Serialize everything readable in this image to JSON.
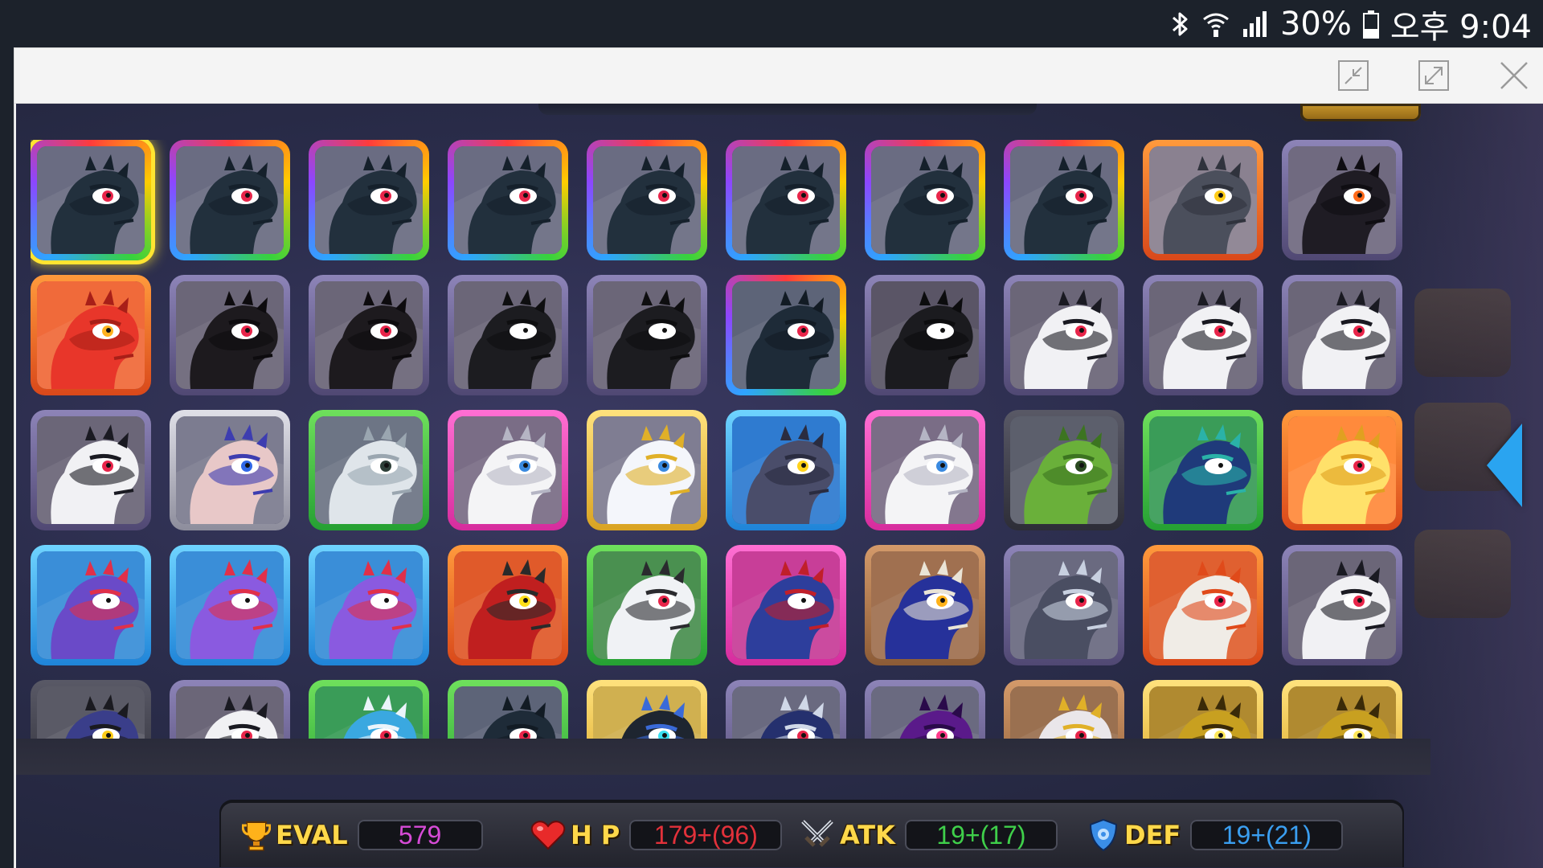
{
  "status_bar": {
    "battery_percent": "30%",
    "time": "오후 9:04",
    "icons": [
      "bluetooth-icon",
      "wifi-icon",
      "signal-icon",
      "battery-icon"
    ]
  },
  "window_controls": [
    "minimize-icon",
    "maximize-icon",
    "close-icon"
  ],
  "stats": {
    "eval": {
      "label": "EVAL",
      "value": "579",
      "color": "#d64bd6"
    },
    "hp": {
      "label": "H P",
      "value": "179+(96)",
      "color": "#e2313a"
    },
    "atk": {
      "label": "ATK",
      "value": "19+(17)",
      "color": "#3fcf4a"
    },
    "def": {
      "label": "DEF",
      "value": "19+(21)",
      "color": "#3a9ef0"
    }
  },
  "grid": {
    "columns": 10,
    "slots": [
      {
        "frame": "rainbow",
        "selected": true,
        "dragon": "dark-godzilla"
      },
      {
        "frame": "rainbow",
        "dragon": "dark-godzilla"
      },
      {
        "frame": "rainbow",
        "dragon": "dark-godzilla"
      },
      {
        "frame": "rainbow",
        "dragon": "dark-godzilla"
      },
      {
        "frame": "rainbow",
        "dragon": "dark-godzilla"
      },
      {
        "frame": "rainbow",
        "dragon": "dark-godzilla"
      },
      {
        "frame": "rainbow",
        "dragon": "dark-godzilla"
      },
      {
        "frame": "rainbow",
        "dragon": "dark-godzilla"
      },
      {
        "frame": "orange",
        "dragon": "gray-spiky"
      },
      {
        "frame": "purple",
        "dragon": "black-fire"
      },
      {
        "frame": "orange",
        "dragon": "red-baby"
      },
      {
        "frame": "purple",
        "dragon": "shadow"
      },
      {
        "frame": "purple",
        "dragon": "shadow"
      },
      {
        "frame": "purple",
        "dragon": "black-gem"
      },
      {
        "frame": "purple",
        "dragon": "black-gem"
      },
      {
        "frame": "rainbow",
        "dragon": "teal-horn"
      },
      {
        "frame": "purple",
        "dragon": "black-gold"
      },
      {
        "frame": "purple",
        "dragon": "white-tribal"
      },
      {
        "frame": "purple",
        "dragon": "white-tribal"
      },
      {
        "frame": "purple",
        "dragon": "white-tribal"
      },
      {
        "frame": "purple",
        "dragon": "white-tribal"
      },
      {
        "frame": "silver",
        "dragon": "blue-lily"
      },
      {
        "frame": "green",
        "dragon": "white-ghost"
      },
      {
        "frame": "pink",
        "dragon": "white-flower"
      },
      {
        "frame": "gold",
        "dragon": "white-gold"
      },
      {
        "frame": "blue",
        "dragon": "steel-bird"
      },
      {
        "frame": "pink",
        "dragon": "white-flower"
      },
      {
        "frame": "dark",
        "dragon": "green-cactus"
      },
      {
        "frame": "green",
        "dragon": "blue-parrot"
      },
      {
        "frame": "orange",
        "dragon": "yellow-baby"
      },
      {
        "frame": "blue",
        "dragon": "purple-coral"
      },
      {
        "frame": "blue",
        "dragon": "purple-baby"
      },
      {
        "frame": "blue",
        "dragon": "purple-baby"
      },
      {
        "frame": "orange",
        "dragon": "red-green"
      },
      {
        "frame": "green",
        "dragon": "white-ram"
      },
      {
        "frame": "pink",
        "dragon": "blue-scroll"
      },
      {
        "frame": "bronze",
        "dragon": "navy-white"
      },
      {
        "frame": "purple",
        "dragon": "silver-armor"
      },
      {
        "frame": "orange",
        "dragon": "fire-white"
      },
      {
        "frame": "purple",
        "dragon": "white-tribal"
      },
      {
        "frame": "dark",
        "dragon": "top-hat"
      },
      {
        "frame": "purple",
        "dragon": "white-tribal"
      },
      {
        "frame": "green",
        "dragon": "ice-blue"
      },
      {
        "frame": "green",
        "dragon": "teal-horn"
      },
      {
        "frame": "gold",
        "dragon": "dark-cyan-eye"
      },
      {
        "frame": "purple",
        "dragon": "navy-armor"
      },
      {
        "frame": "purple",
        "dragon": "purple-armor"
      },
      {
        "frame": "bronze",
        "dragon": "gold-white"
      },
      {
        "frame": "gold",
        "dragon": "gold-spike"
      },
      {
        "frame": "gold",
        "dragon": "gold-spike"
      }
    ]
  },
  "palettes": {
    "dark-godzilla": {
      "skin": "#22303d",
      "shade": "#15202b",
      "eye": "#e8254a",
      "bg": "#6a6c82"
    },
    "gray-spiky": {
      "skin": "#4b4f5c",
      "shade": "#30333d",
      "eye": "#ffcc18",
      "bg": "#8a8190"
    },
    "black-fire": {
      "skin": "#1f1c24",
      "shade": "#0f0d12",
      "eye": "#ff6a1a",
      "bg": "#706a80"
    },
    "red-baby": {
      "skin": "#e8362a",
      "shade": "#a81f18",
      "eye": "#ffb21f",
      "bg": "#f06a3a"
    },
    "shadow": {
      "skin": "#1d1a1e",
      "shade": "#0d0b0e",
      "eye": "#e8254a",
      "bg": "#6b6678"
    },
    "black-gem": {
      "skin": "#1c1c20",
      "shade": "#0e0e10",
      "eye": "#ffffff",
      "bg": "#6b6678"
    },
    "teal-horn": {
      "skin": "#1e2b38",
      "shade": "#121b24",
      "eye": "#e8254a",
      "bg": "#5d6478"
    },
    "black-gold": {
      "skin": "#1b1b1f",
      "shade": "#0c0c0e",
      "eye": "#ffffff",
      "bg": "#5a5566"
    },
    "white-tribal": {
      "skin": "#f1f1f4",
      "shade": "#1a1a22",
      "eye": "#e8254a",
      "bg": "#6b6678"
    },
    "blue-lily": {
      "skin": "#e8c8c8",
      "shade": "#3d3db0",
      "eye": "#3068e8",
      "bg": "#7c7c90"
    },
    "white-ghost": {
      "skin": "#dfe5ea",
      "shade": "#9aa6b0",
      "eye": "#2d3f38",
      "bg": "#6d7585"
    },
    "white-flower": {
      "skin": "#f4f4f6",
      "shade": "#b5b5c4",
      "eye": "#3a8ae0",
      "bg": "#7a6d86"
    },
    "white-gold": {
      "skin": "#f4f6fb",
      "shade": "#e0b028",
      "eye": "#3a8ae0",
      "bg": "#7f7d92"
    },
    "steel-bird": {
      "skin": "#4a4d6a",
      "shade": "#2a2c40",
      "eye": "#ffd21a",
      "bg": "#2f7bd0"
    },
    "green-cactus": {
      "skin": "#6ab03a",
      "shade": "#3c7420",
      "eye": "#2a4a20",
      "bg": "#5c5f6c"
    },
    "blue-parrot": {
      "skin": "#1f3a7a",
      "shade": "#2ab2a8",
      "eye": "#ffffff",
      "bg": "#3a9c58"
    },
    "yellow-baby": {
      "skin": "#ffe16a",
      "shade": "#e0a020",
      "eye": "#e8254a",
      "bg": "#ff8a3c"
    },
    "purple-coral": {
      "skin": "#6a4ac8",
      "shade": "#e0304a",
      "eye": "#ffffff",
      "bg": "#3a8ed8"
    },
    "purple-baby": {
      "skin": "#8a5ae0",
      "shade": "#e0304a",
      "eye": "#ffffff",
      "bg": "#3a8ed8"
    },
    "red-green": {
      "skin": "#c01f1f",
      "shade": "#2a2a2a",
      "eye": "#ffe01a",
      "bg": "#e05a2a"
    },
    "white-ram": {
      "skin": "#f0f2f5",
      "shade": "#2a2a2e",
      "eye": "#e8254a",
      "bg": "#4a9050"
    },
    "blue-scroll": {
      "skin": "#2d3e9c",
      "shade": "#c01f2a",
      "eye": "#ffffff",
      "bg": "#c83e98"
    },
    "navy-white": {
      "skin": "#26319a",
      "shade": "#eae4d6",
      "eye": "#ffb21a",
      "bg": "#a07050"
    },
    "silver-armor": {
      "skin": "#4a4e62",
      "shade": "#c8d0e0",
      "eye": "#e8254a",
      "bg": "#6a6a80"
    },
    "fire-white": {
      "skin": "#f0ece6",
      "shade": "#e04a1a",
      "eye": "#e8254a",
      "bg": "#e06030"
    },
    "top-hat": {
      "skin": "#3a3e8a",
      "shade": "#1a1a20",
      "eye": "#ffcc18",
      "bg": "#5a5a66"
    },
    "ice-blue": {
      "skin": "#3aa8e0",
      "shade": "#eaf4fa",
      "eye": "#e8254a",
      "bg": "#3a9c58"
    },
    "dark-cyan-eye": {
      "skin": "#1e2530",
      "shade": "#3a6ad8",
      "eye": "#3ae0f0",
      "bg": "#d0b050"
    },
    "navy-armor": {
      "skin": "#25306e",
      "shade": "#d0d8e8",
      "eye": "#e8254a",
      "bg": "#6a6a80"
    },
    "purple-armor": {
      "skin": "#5a1a8a",
      "shade": "#2a0a4a",
      "eye": "#ff3a8a",
      "bg": "#6a6a80"
    },
    "gold-white": {
      "skin": "#eae6ea",
      "shade": "#e0b028",
      "eye": "#e8254a",
      "bg": "#9a7050"
    },
    "gold-spike": {
      "skin": "#c8a020",
      "shade": "#3a2a08",
      "eye": "#ffe85a",
      "bg": "#b08a30"
    }
  }
}
